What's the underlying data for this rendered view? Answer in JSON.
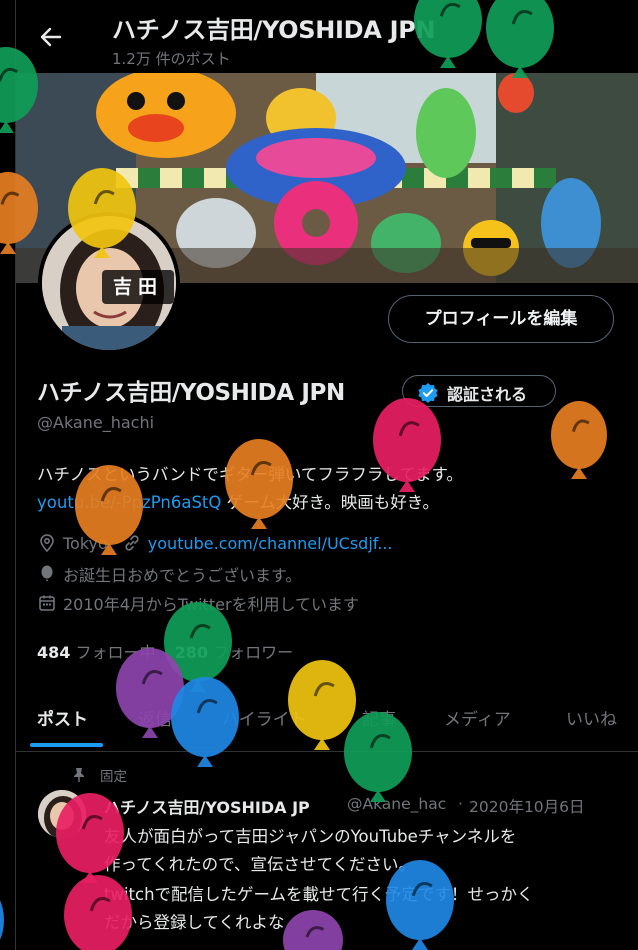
{
  "header": {
    "title": "ハチノス吉田/YOSHIDA JPN",
    "post_count": "1.2万 件のポスト"
  },
  "avatar": {
    "tag": "吉田"
  },
  "edit_button": "プロフィールを編集",
  "profile": {
    "name": "ハチノス吉田/YOSHIDA JPN",
    "verified_label": "認証される",
    "handle": "@Akane_hachi",
    "bio_line1": "ハチノスというバンドでギター弾いてフラフラしてます。",
    "bio_link": "youtu.be/-PpzPn6aStQ",
    "bio_line2_rest": " ゲーム大好き。映画も好き。",
    "location": "Tokyo",
    "website": "youtube.com/channel/UCsdjf...",
    "birthday": "お誕生日おめでとうございます。",
    "joined": "2010年4月からTwitterを利用しています"
  },
  "stats": {
    "following_count": "484",
    "following_label": "フォロー中",
    "followers_count": "280",
    "followers_label": "フォロワー"
  },
  "tabs": [
    "ポスト",
    "返信",
    "ハイライト",
    "記事",
    "メディア",
    "いいね"
  ],
  "active_tab": "ポスト",
  "pinned": {
    "label": "固定",
    "name": "ハチノス吉田/YOSHIDA JP",
    "handle": "@Akane_hac",
    "separator": "·",
    "date": "2020年10月6日",
    "lines": [
      "友人が面白がって吉田ジャパンのYouTubeチャンネルを",
      "作ってくれたので、宣伝させてください。",
      "twitchで配信したゲームを載せて行く予定です！せっかく",
      "だから登録してくれよな"
    ]
  },
  "colors": {
    "background": "#000000",
    "text": "#e7e9ea",
    "muted": "#71767b",
    "link": "#1d9bf0",
    "border": "#2f3336",
    "verified": "#1d9bf0"
  },
  "decorations": {
    "balloon_colors": [
      "#0f9d58",
      "#e67e22",
      "#f1c40f",
      "#e91e63",
      "#1e88e5",
      "#8e44ad"
    ]
  }
}
